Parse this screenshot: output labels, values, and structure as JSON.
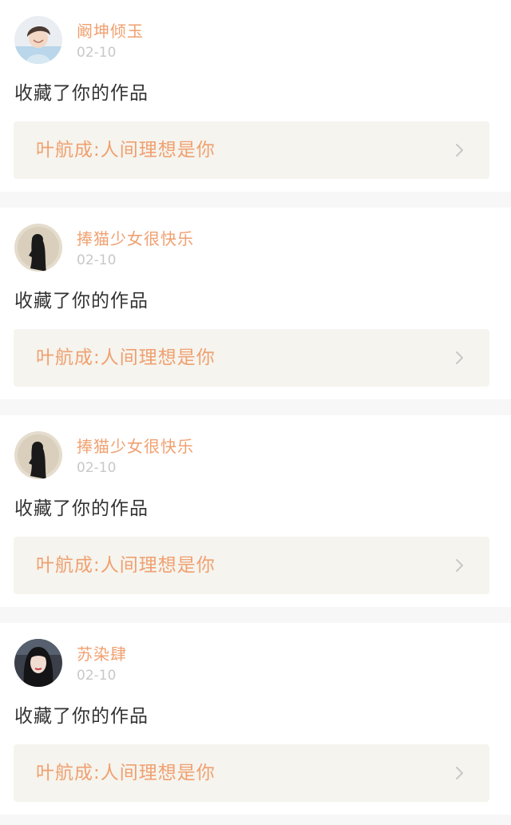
{
  "notifications": [
    {
      "avatar_icon": "boy-portrait-avatar",
      "username": "阚坤倾玉",
      "date": "02-10",
      "action": "收藏了你的作品",
      "work_title": "叶航成:人间理想是你"
    },
    {
      "avatar_icon": "girl-silhouette-avatar",
      "username": "捧猫少女很快乐",
      "date": "02-10",
      "action": "收藏了你的作品",
      "work_title": "叶航成:人间理想是你"
    },
    {
      "avatar_icon": "girl-silhouette-avatar",
      "username": "捧猫少女很快乐",
      "date": "02-10",
      "action": "收藏了你的作品",
      "work_title": "叶航成:人间理想是你"
    },
    {
      "avatar_icon": "woman-portrait-avatar",
      "username": "苏染肆",
      "date": "02-10",
      "action": "收藏了你的作品",
      "work_title": "叶航成:人间理想是你"
    }
  ],
  "colors": {
    "accent": "#f0a070",
    "date": "#c8c8c8",
    "text": "#333333",
    "link_bg": "#f5f4ee",
    "separator": "#f7f7f7"
  }
}
